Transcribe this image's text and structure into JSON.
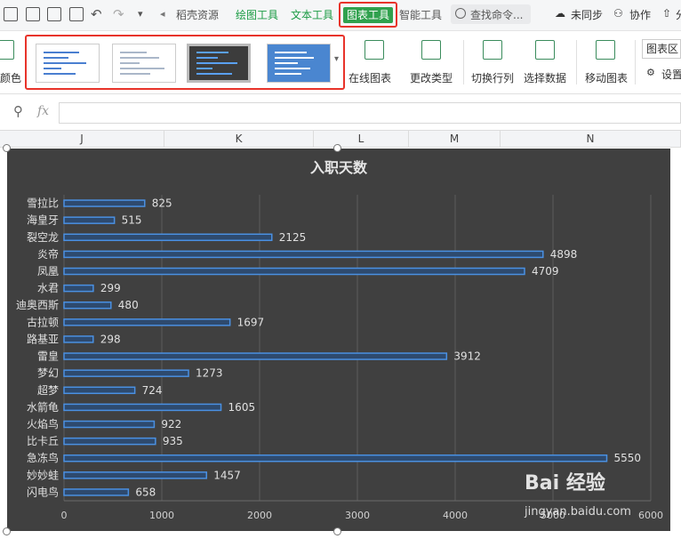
{
  "toolbar": {
    "tabs": [
      {
        "label": "稻壳资源"
      },
      {
        "label": "绘图工具"
      },
      {
        "label": "文本工具"
      },
      {
        "label": "图表工具"
      },
      {
        "label": "智能工具"
      }
    ],
    "search_label": "查找命令...",
    "unsynced_label": "未同步",
    "collab_label": "协作",
    "share_label": "分"
  },
  "ribbon": {
    "color_label": "颜色",
    "online_chart_label": "在线图表",
    "change_type_label": "更改类型",
    "switch_row_col_label": "切换行列",
    "select_data_label": "选择数据",
    "move_chart_label": "移动图表",
    "chart_area_value": "图表区",
    "settings_label": "设置"
  },
  "formula_bar": {
    "fx_label": "fx",
    "value": ""
  },
  "columns": [
    "J",
    "K",
    "L",
    "M",
    "N"
  ],
  "chart_data": {
    "type": "bar",
    "title": "入职天数",
    "categories": [
      "雪拉比",
      "海皇牙",
      "裂空龙",
      "炎帝",
      "凤凰",
      "水君",
      "迪奥西斯",
      "古拉顿",
      "路基亚",
      "雷皇",
      "梦幻",
      "超梦",
      "水箭龟",
      "火焰鸟",
      "比卡丘",
      "急冻鸟",
      "妙妙蛙",
      "闪电鸟"
    ],
    "values": [
      825,
      515,
      2125,
      4898,
      4709,
      299,
      480,
      1697,
      298,
      3912,
      1273,
      724,
      1605,
      922,
      935,
      5550,
      1457,
      658
    ],
    "xlim": [
      0,
      6000
    ],
    "xticks": [
      "0",
      "1000",
      "2000",
      "3000",
      "4000",
      "5000",
      "6000"
    ],
    "grid": true,
    "bar_color": "#4a90e2",
    "background": "#404040"
  },
  "watermark": {
    "brand": "Bai 经验",
    "url": "jingyan.baidu.com"
  }
}
